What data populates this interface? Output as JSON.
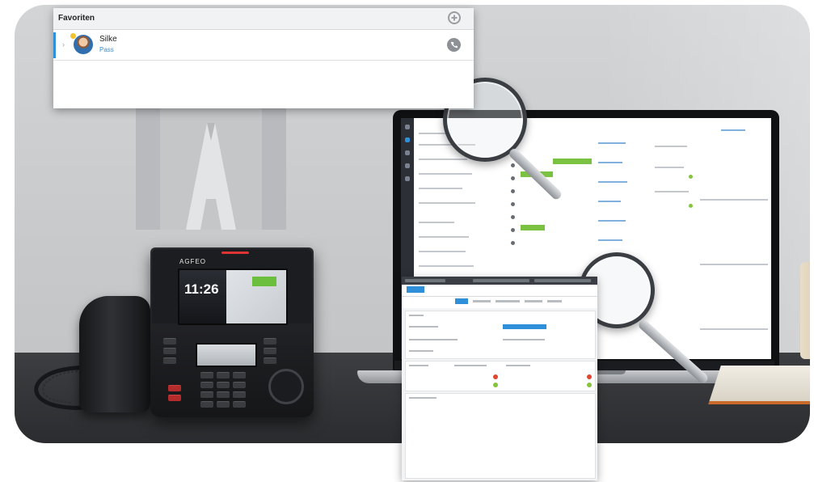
{
  "favourites": {
    "title": "Favoriten",
    "add_icon": "plus-circle-icon",
    "entries": [
      {
        "name": "Silke",
        "status": "Pass",
        "presence_color": "#f2c12e",
        "call_icon": "phone-icon"
      }
    ]
  },
  "desk_phone": {
    "brand": "AGFEO",
    "time": "11:26"
  },
  "colors": {
    "accent": "#2f8fd8",
    "green": "#7cc242",
    "red": "#e0452f"
  }
}
